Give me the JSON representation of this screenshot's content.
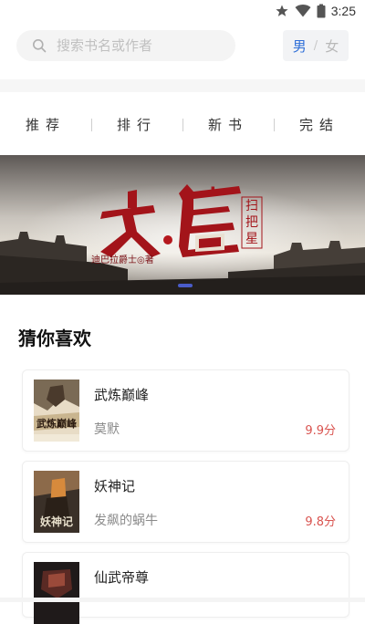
{
  "status_bar": {
    "time": "3:25",
    "icons": [
      "star-icon",
      "wifi-icon",
      "battery-icon"
    ]
  },
  "search": {
    "placeholder": "搜索书名或作者",
    "value": ""
  },
  "gender_toggle": {
    "male": "男",
    "separator": "/",
    "female": "女",
    "selected": "男"
  },
  "tabs": [
    {
      "label": "推荐"
    },
    {
      "label": "排行"
    },
    {
      "label": "新书"
    },
    {
      "label": "完结"
    }
  ],
  "banner": {
    "title": "大唐",
    "subtitle": "扫把星",
    "author": "迪巴拉爵士◎著",
    "page_index": 1,
    "page_count": 1
  },
  "section": {
    "title": "猜你喜欢"
  },
  "books": [
    {
      "title": "武炼巅峰",
      "author": "莫默",
      "score": "9.9分",
      "cover_text": "武炼巅峰"
    },
    {
      "title": "妖神记",
      "author": "发飙的蜗牛",
      "score": "9.8分",
      "cover_text": "妖神记"
    },
    {
      "title": "仙武帝尊",
      "author": "",
      "score": "",
      "cover_text": ""
    }
  ],
  "colors": {
    "accent": "#2f6fd8",
    "score": "#d9534f",
    "banner_title": "#a3141a",
    "indicator": "#4a5cc8"
  }
}
